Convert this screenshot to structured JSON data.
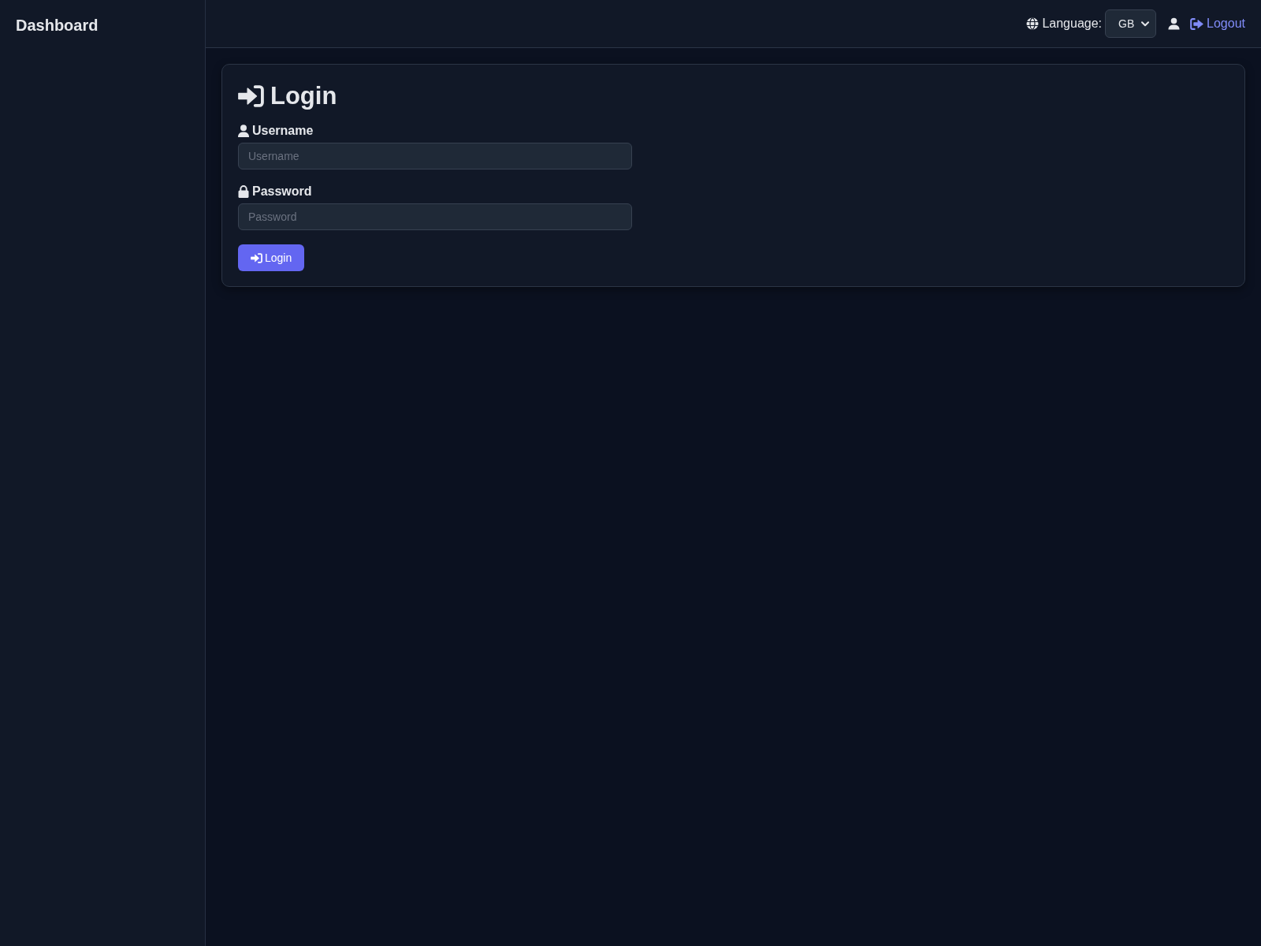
{
  "sidebar": {
    "title": "Dashboard"
  },
  "header": {
    "language_label": "Language:",
    "language_select": {
      "value": "GB"
    },
    "logout_link": "Logout"
  },
  "login_card": {
    "title": "Login",
    "fields": [
      {
        "kind": "text",
        "label": "Username",
        "placeholder": "Username"
      },
      {
        "kind": "password",
        "label": "Password",
        "placeholder": "Password"
      }
    ],
    "submit_button": "Login"
  }
}
